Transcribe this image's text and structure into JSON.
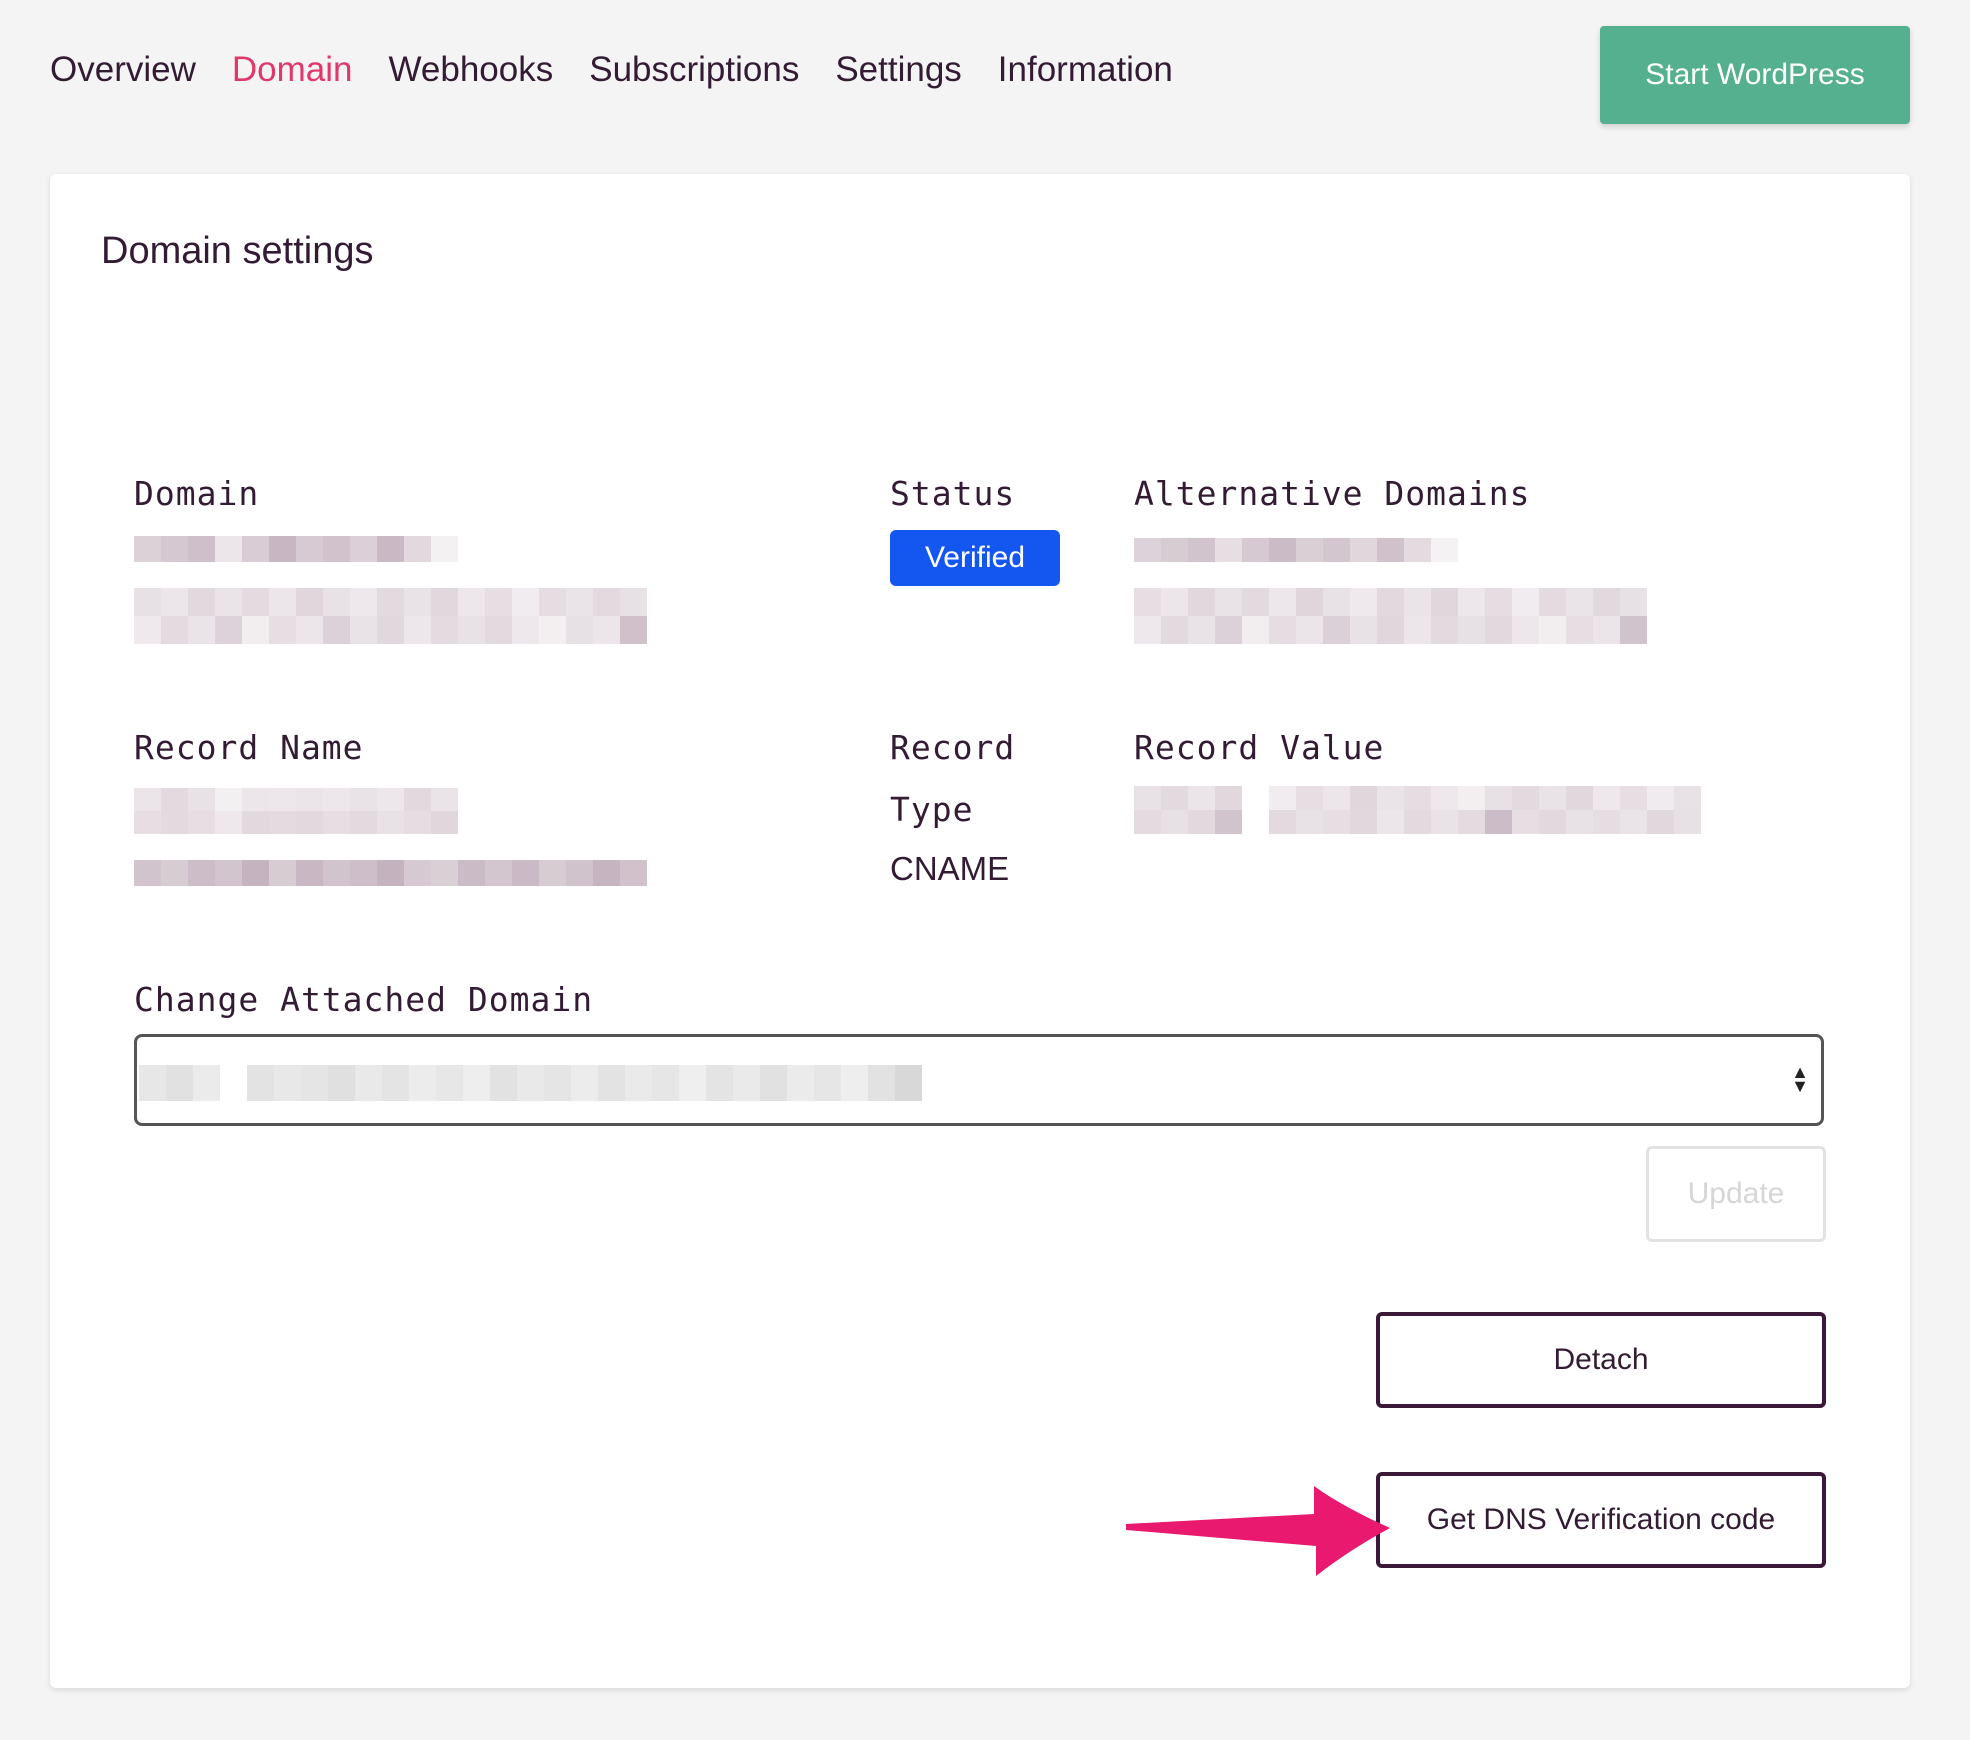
{
  "nav": {
    "items": [
      {
        "label": "Overview",
        "active": false
      },
      {
        "label": "Domain",
        "active": true
      },
      {
        "label": "Webhooks",
        "active": false
      },
      {
        "label": "Subscriptions",
        "active": false
      },
      {
        "label": "Settings",
        "active": false
      },
      {
        "label": "Information",
        "active": false
      }
    ],
    "start_button": "Start WordPress"
  },
  "card": {
    "title": "Domain settings",
    "domain_label": "Domain",
    "status_label": "Status",
    "status_value": "Verified",
    "alt_domains_label": "Alternative Domains",
    "record_name_label": "Record Name",
    "record_type_label_1": "Record",
    "record_type_label_2": "Type",
    "record_type_value": "CNAME",
    "record_value_label": "Record Value",
    "change_label": "Change Attached Domain",
    "update_button": "Update",
    "detach_button": "Detach",
    "dns_button": "Get DNS Verification code"
  },
  "colors": {
    "accent_active": "#e0386a",
    "start_button": "#55b08f",
    "status_badge": "#1357f0",
    "annotation_arrow": "#e8196e"
  }
}
